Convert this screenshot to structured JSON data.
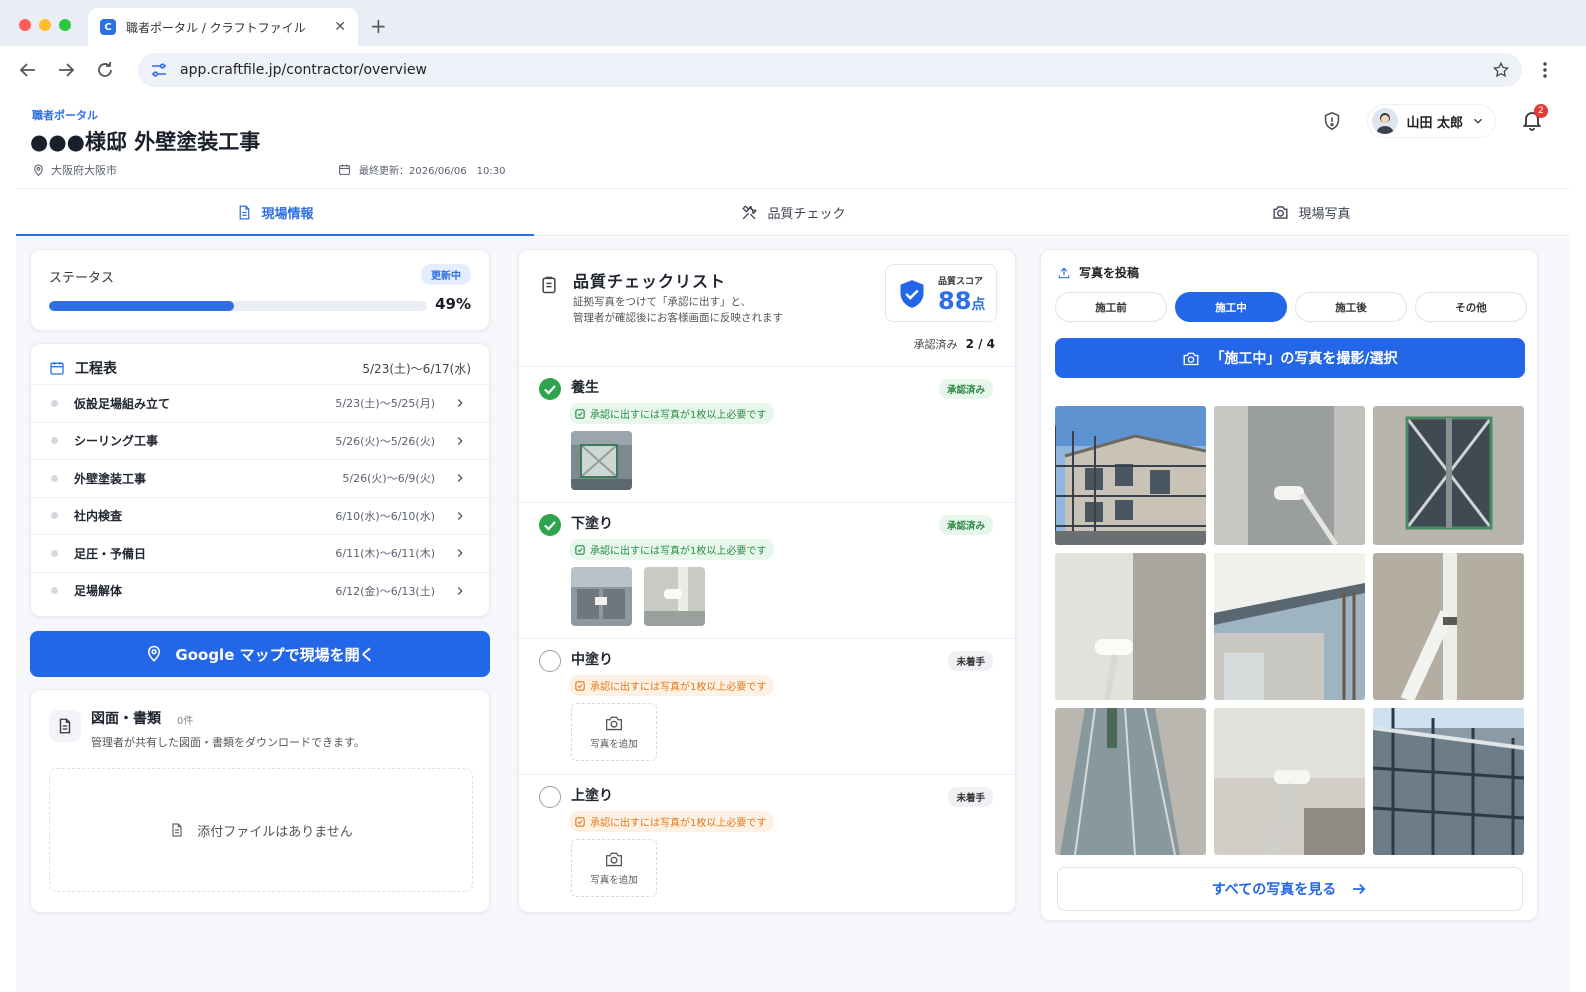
{
  "browser": {
    "tab_title": "職者ポータル / クラフトファイル",
    "favicon_letter": "C",
    "url": "app.craftfile.jp/contractor/overview"
  },
  "header": {
    "portal_label": "職者ポータル",
    "title": "●●●様邸 外壁塗装工事",
    "location": "大阪府大阪市",
    "last_updated": "最終更新：2026/06/06　10:30",
    "user_name": "山田 太郎",
    "notification_count": "2"
  },
  "tabs": [
    {
      "label": "現場情報",
      "icon": "document-icon"
    },
    {
      "label": "品質チェック",
      "icon": "tools-icon"
    },
    {
      "label": "現場写真",
      "icon": "camera-icon"
    }
  ],
  "status": {
    "title": "ステータス",
    "badge": "更新中",
    "progress": 49,
    "progress_label": "49%"
  },
  "schedule": {
    "title": "工程表",
    "range": "5/23(土)〜6/17(水)",
    "items": [
      {
        "name": "仮設足場組み立て",
        "dates": "5/23(土)〜5/25(月)"
      },
      {
        "name": "シーリング工事",
        "dates": "5/26(火)〜5/26(火)"
      },
      {
        "name": "外壁塗装工事",
        "dates": "5/26(火)〜6/9(火)"
      },
      {
        "name": "社内検査",
        "dates": "6/10(水)〜6/10(水)"
      },
      {
        "name": "足圧・予備日",
        "dates": "6/11(木)〜6/11(木)"
      },
      {
        "name": "足場解体",
        "dates": "6/12(金)〜6/13(土)"
      }
    ]
  },
  "maps_button": "Google マップで現場を開く",
  "documents": {
    "title": "図面・書類",
    "count": "0件",
    "description": "管理者が共有した図面・書類をダウンロードできます。",
    "empty": "添付ファイルはありません"
  },
  "quality": {
    "title": "品質チェックリスト",
    "desc_line1": "証拠写真をつけて「承認に出す」と、",
    "desc_line2": "管理者が確認後にお客様画面に反映されます",
    "score_label": "品質スコア",
    "score_value": "88",
    "score_unit": "点",
    "approved_label": "承認済み",
    "approved_count": "2 / 4",
    "requirement": "承認に出すには写真が1枚以上必要です",
    "add_photo": "写真を追加",
    "items": [
      {
        "name": "養生",
        "status": "承認済み",
        "done": true
      },
      {
        "name": "下塗り",
        "status": "承認済み",
        "done": true
      },
      {
        "name": "中塗り",
        "status": "未着手",
        "done": false
      },
      {
        "name": "上塗り",
        "status": "未着手",
        "done": false
      }
    ]
  },
  "photos": {
    "title": "写真を投稿",
    "phases": [
      "施工前",
      "施工中",
      "施工後",
      "その他"
    ],
    "active_phase": "施工中",
    "capture_button": "「施工中」の写真を撮影/選択",
    "view_all": "すべての写真を見る"
  },
  "colors": {
    "accent": "#2466e8",
    "success": "#2ea44f",
    "warning": "#e07a1f"
  }
}
